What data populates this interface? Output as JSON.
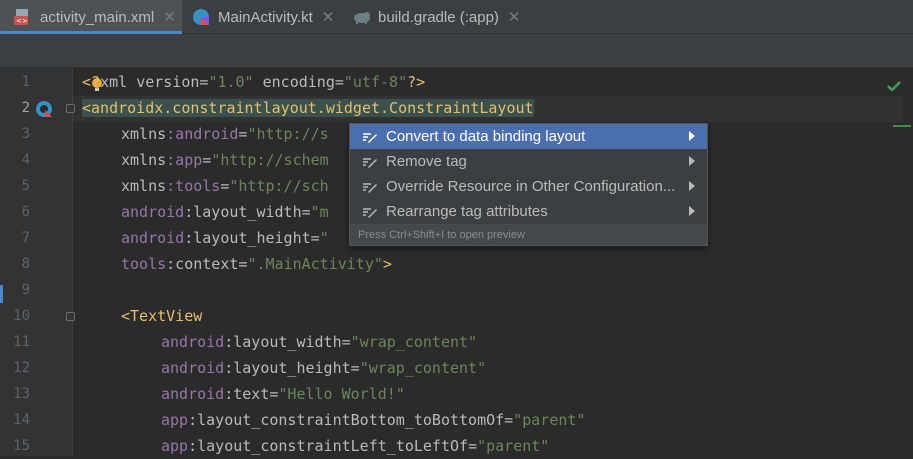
{
  "tabs": [
    {
      "label": "activity_main.xml",
      "icon": "xml-file-icon",
      "active": true
    },
    {
      "label": "MainActivity.kt",
      "icon": "kotlin-file-icon",
      "active": false
    },
    {
      "label": "build.gradle (:app)",
      "icon": "gradle-elephant-icon",
      "active": false
    }
  ],
  "tab_close_glyph": "✕",
  "line_numbers": [
    "1",
    "2",
    "3",
    "4",
    "5",
    "6",
    "7",
    "8",
    "9",
    "10",
    "11",
    "12",
    "13",
    "14",
    "15"
  ],
  "code": {
    "l1": {
      "a": "<",
      "b": "?",
      "c": "xml ",
      "d": "version",
      "e": "=",
      "f": "\"1.0\"",
      "g": " encoding",
      "h": "=",
      "i": "\"utf-8\"",
      "j": "?>"
    },
    "l2": {
      "a": "<androidx.constraintlayout.widget.ConstraintLayout"
    },
    "l3": {
      "a": "xmlns",
      "b": ":android",
      "c": "=",
      "d": "\"http://s"
    },
    "l4": {
      "a": "xmlns",
      "b": ":app",
      "c": "=",
      "d": "\"http://schem"
    },
    "l5": {
      "a": "xmlns",
      "b": ":tools",
      "c": "=",
      "d": "\"http://sch"
    },
    "l6": {
      "a": "android",
      "b": ":layout_width",
      "c": "=",
      "d": "\"m"
    },
    "l7": {
      "a": "android",
      "b": ":layout_height",
      "c": "=",
      "d": "\""
    },
    "l8": {
      "a": "tools",
      "b": ":context",
      "c": "=",
      "d": "\".MainActivity\"",
      "e": ">"
    },
    "l10": {
      "a": "<TextView"
    },
    "l11": {
      "a": "android",
      "b": ":layout_width",
      "c": "=",
      "d": "\"wrap_content\""
    },
    "l12": {
      "a": "android",
      "b": ":layout_height",
      "c": "=",
      "d": "\"wrap_content\""
    },
    "l13": {
      "a": "android",
      "b": ":text",
      "c": "=",
      "d": "\"Hello World!\""
    },
    "l14": {
      "a": "app",
      "b": ":layout_constraintBottom_toBottomOf",
      "c": "=",
      "d": "\"parent\""
    },
    "l15": {
      "a": "app",
      "b": ":layout_constraintLeft_toLeftOf",
      "c": "=",
      "d": "\"parent\""
    }
  },
  "context_menu": {
    "items": [
      {
        "label": "Convert to data binding layout",
        "selected": true
      },
      {
        "label": "Remove tag",
        "selected": false
      },
      {
        "label": "Override Resource in Other Configuration...",
        "selected": false
      },
      {
        "label": "Rearrange tag attributes",
        "selected": false
      }
    ],
    "footer": "Press Ctrl+Shift+I to open preview"
  },
  "colors": {
    "editor_bg": "#2b2b2b",
    "gutter_bg": "#313335",
    "selection": "#4b6eaf",
    "string": "#6a8759",
    "tag": "#e8bf6a",
    "namespace": "#9876aa"
  }
}
